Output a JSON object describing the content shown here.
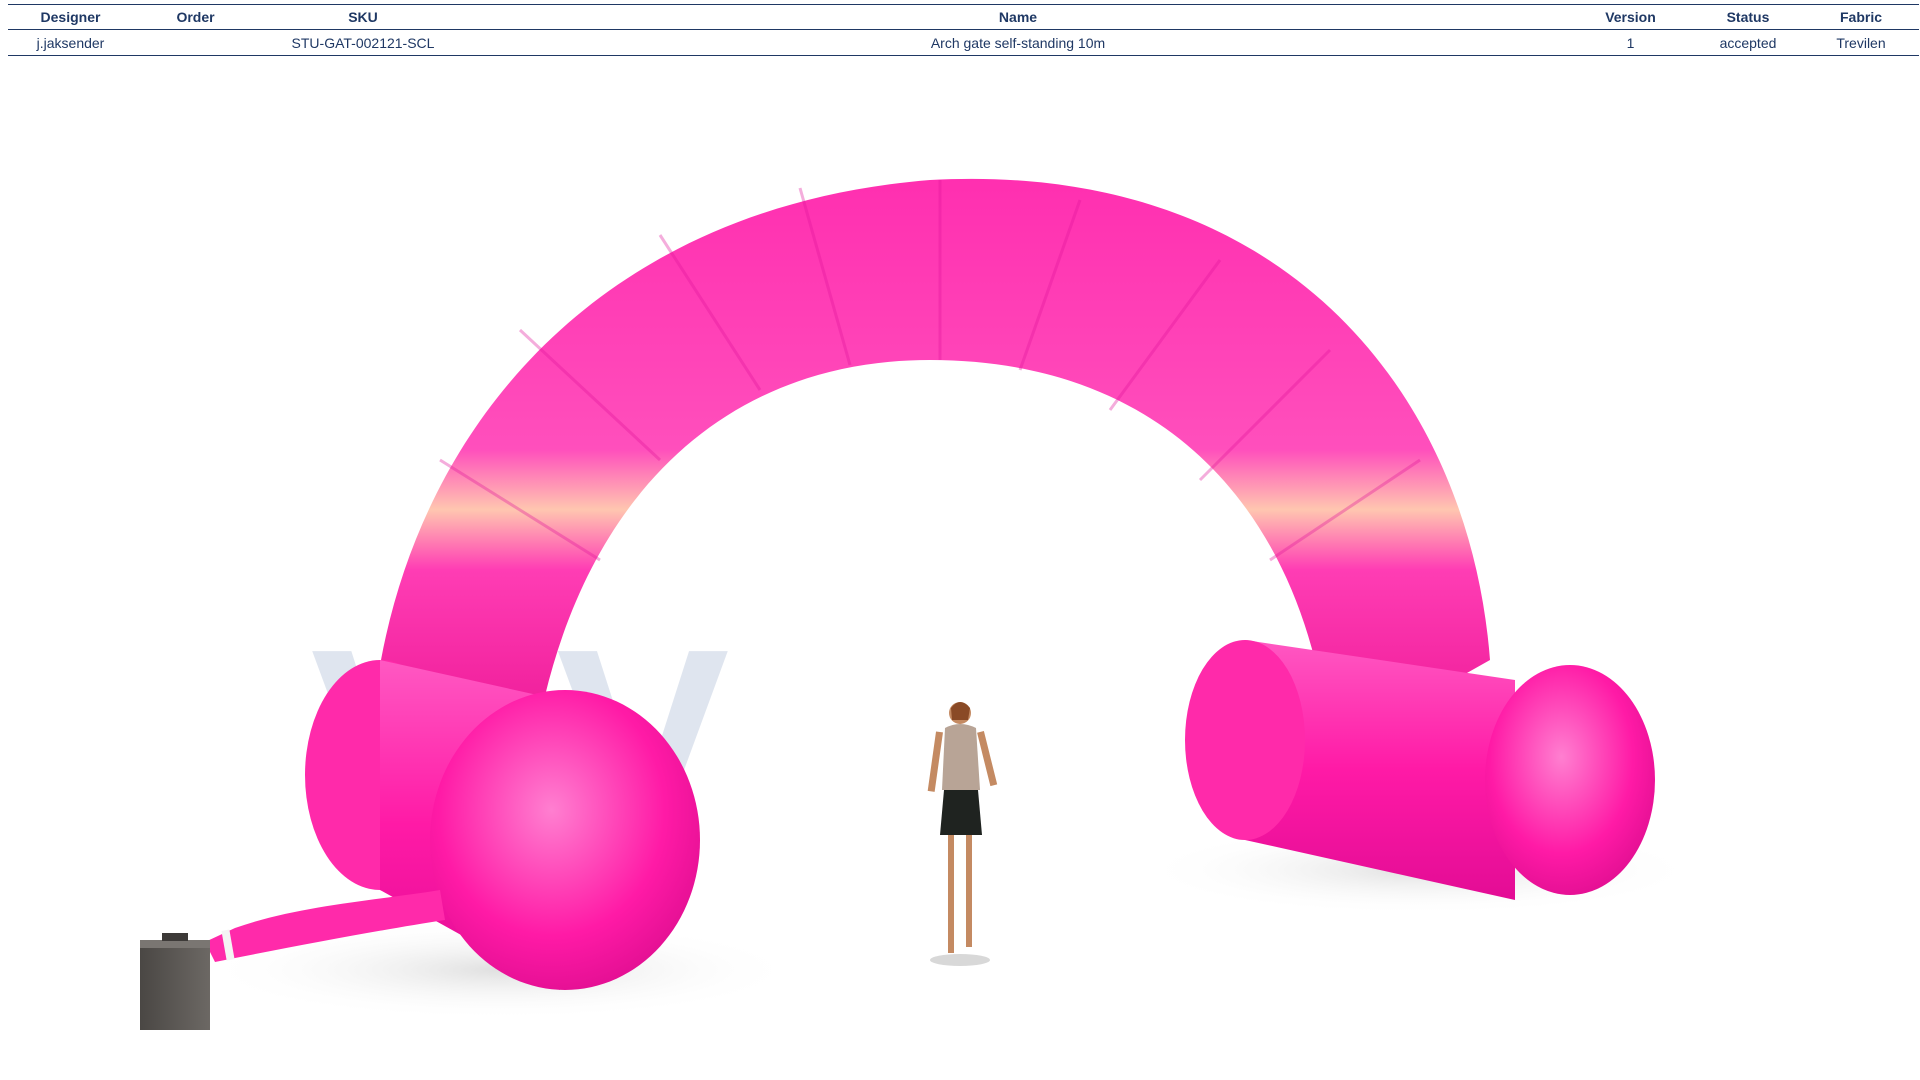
{
  "spec": {
    "headers": {
      "designer": "Designer",
      "order": "Order",
      "sku": "SKU",
      "name": "Name",
      "version": "Version",
      "status": "Status",
      "fabric": "Fabric"
    },
    "row": {
      "designer": "j.jaksender",
      "order": "",
      "sku": "STU-GAT-002121-SCL",
      "name": "Arch gate self-standing 10m",
      "version": "1",
      "status": "accepted",
      "fabric": "Trevilen"
    }
  },
  "render": {
    "watermark_text": "VIV",
    "arch_color": "#ff1aa6",
    "arch_highlight": "#ffd0a0",
    "blower_color": "#5e5a56"
  },
  "icons": {
    "blower": "blower-box-icon",
    "person": "person-scale-figure-icon"
  }
}
